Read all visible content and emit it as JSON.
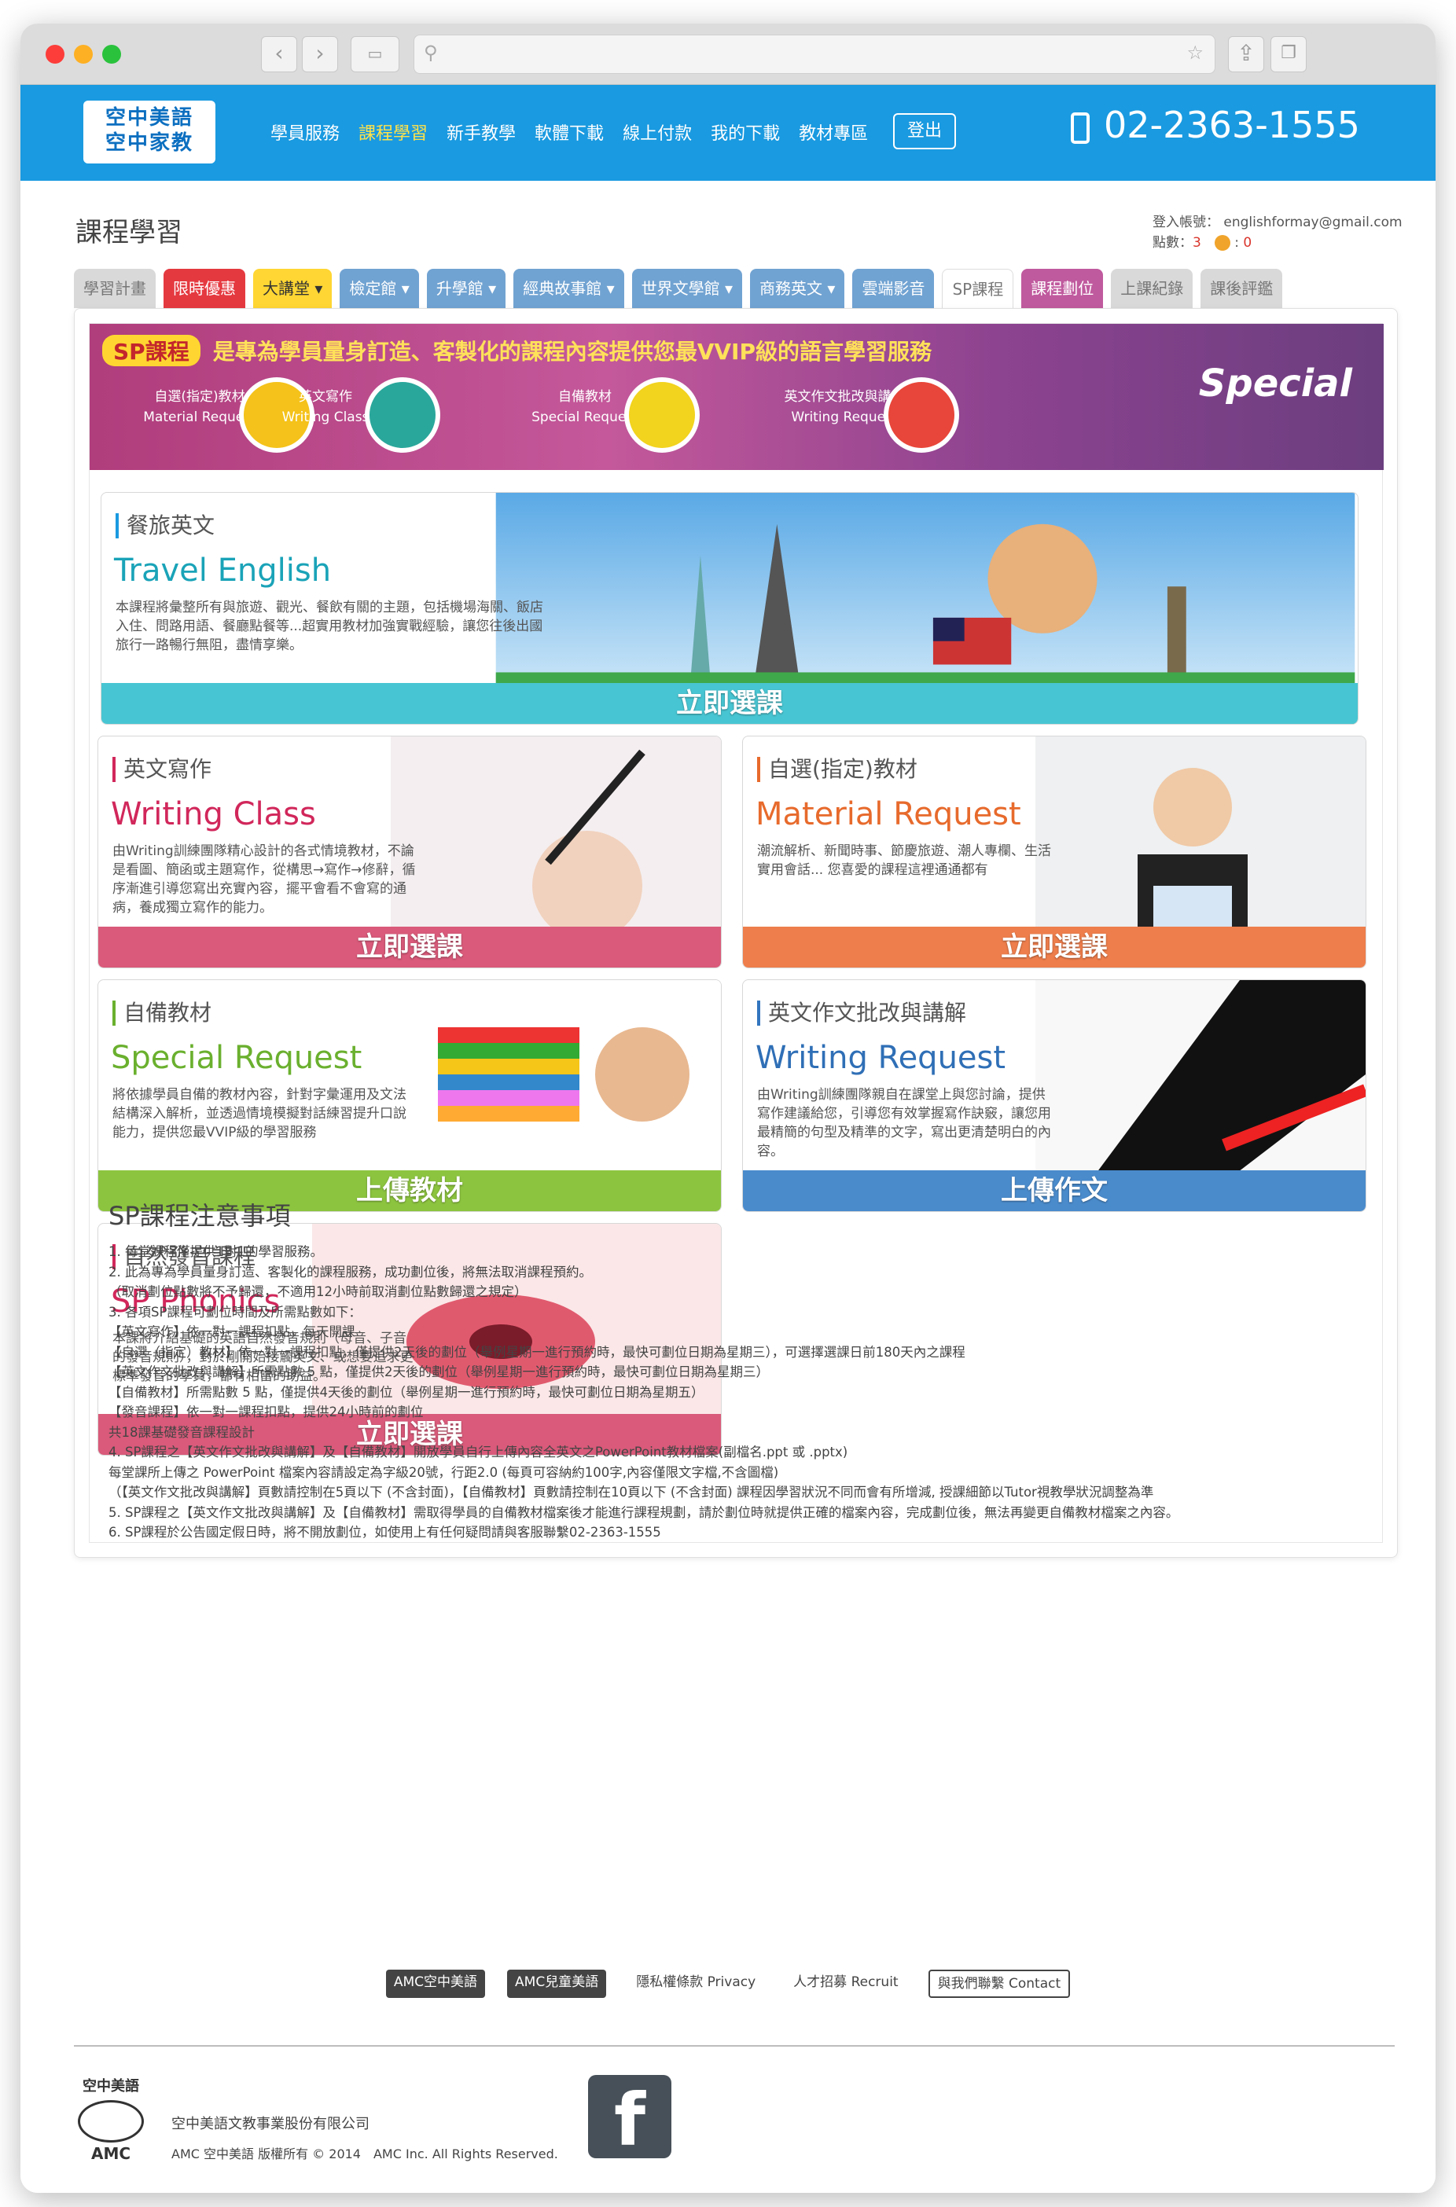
{
  "header": {
    "logo_line1": "空中美語",
    "logo_line2": "空中家教",
    "nav": [
      "學員服務",
      "課程學習",
      "新手教學",
      "軟體下載",
      "線上付款",
      "我的下載",
      "教材專區"
    ],
    "logout": "登出",
    "phone": "02-2363-1555"
  },
  "page": {
    "title": "課程學習",
    "account_label": "登入帳號：",
    "account": "englishformay@gmail.com",
    "points_label": "點數：",
    "points": "3",
    "coin_points": "0"
  },
  "tabs": [
    {
      "label": "學習計畫",
      "bg": "#d9d9d9",
      "color": "#777"
    },
    {
      "label": "限時優惠",
      "bg": "#e53940",
      "color": "#fff"
    },
    {
      "label": "大講堂 ▾",
      "bg": "#ffd633",
      "color": "#333"
    },
    {
      "label": "檢定館 ▾",
      "bg": "#71a3d2",
      "color": "#fff"
    },
    {
      "label": "升學館 ▾",
      "bg": "#71a3d2",
      "color": "#fff"
    },
    {
      "label": "經典故事館 ▾",
      "bg": "#71a3d2",
      "color": "#fff"
    },
    {
      "label": "世界文學館 ▾",
      "bg": "#71a3d2",
      "color": "#fff"
    },
    {
      "label": "商務英文 ▾",
      "bg": "#71a3d2",
      "color": "#fff"
    },
    {
      "label": "雲端影音",
      "bg": "#71a3d2",
      "color": "#fff"
    },
    {
      "label": "SP課程",
      "bg": "#ffffff",
      "color": "#777"
    },
    {
      "label": "課程劃位",
      "bg": "#c05a9e",
      "color": "#fff"
    },
    {
      "label": "上課紀錄",
      "bg": "#d9d9d9",
      "color": "#777"
    },
    {
      "label": "課後評鑑",
      "bg": "#d9d9d9",
      "color": "#777"
    }
  ],
  "banner": {
    "badge": "SP課程",
    "headline": "是專為學員量身訂造、客製化的課程內容提供您最VVIP級的語言學習服務",
    "items": [
      {
        "zh": "自選(指定)教材",
        "en": "Material Request"
      },
      {
        "zh": "英文寫作",
        "en": "Writing Class"
      },
      {
        "zh": "自備教材",
        "en": "Special Request"
      },
      {
        "zh": "英文作文批改與講解",
        "en": "Writing Request"
      }
    ],
    "special": "Special"
  },
  "cards": {
    "travel": {
      "zh": "餐旅英文",
      "en": "Travel English",
      "desc": "本課程將彙整所有與旅遊、觀光、餐飲有關的主題，包括機場海關、飯店入住、問路用語、餐廳點餐等...超實用教材加強實戰經驗，讓您往後出國旅行一路暢行無阻，盡情享樂。",
      "button": "立即選課"
    },
    "writing": {
      "zh": "英文寫作",
      "en": "Writing Class",
      "desc": "由Writing訓練團隊精心設計的各式情境教材，不論是看圖、簡函或主題寫作，從構思→寫作→修辭，循序漸進引導您寫出充實內容，擺平會看不會寫的通病，養成獨立寫作的能力。",
      "button": "立即選課"
    },
    "material": {
      "zh": "自選(指定)教材",
      "en": "Material Request",
      "desc": "潮流解析、新聞時事、節慶旅遊、潮人專欄、生活實用會話... 您喜愛的課程這裡通通都有",
      "button": "立即選課"
    },
    "special": {
      "zh": "自備教材",
      "en": "Special Request",
      "desc": "將依據學員自備的教材內容，針對字彙運用及文法結構深入解析，並透過情境模擬對話練習提升口說能力，提供您最VVIP級的學習服務",
      "button": "上傳教材"
    },
    "wrequest": {
      "zh": "英文作文批改與講解",
      "en": "Writing Request",
      "desc": "由Writing訓練團隊親自在課堂上與您討論，提供寫作建議給您，引導您有效掌握寫作訣竅，讓您用最精簡的句型及精準的文字，寫出更清楚明白的內容。",
      "button": "上傳作文"
    },
    "phonics": {
      "zh": "自然發音課程",
      "en": "SP Phonics",
      "desc": "本課將介紹基礎的英語自然發音規則（母音、子音的發音規則），對於剛開始接觸英文、或想要追求更標準發音的學員，都有相當的助益。",
      "button": "立即選課"
    }
  },
  "notes": {
    "title": "SP課程注意事項",
    "lines": [
      "1. 每堂課程僅提供1對1的學習服務。",
      "2. 此為專為學員量身訂造、客製化的課程服務，成功劃位後，將無法取消課程預約。",
      "（取消劃位點數將不予歸還，不適用12小時前取消劃位點數歸還之規定）",
      "3. 各項SP課程可劃位時間及所需點數如下：",
      "【英文寫作】依一對一課程扣點，每天開課",
      "【自選（指定）教材】依一對一課程扣點，僅提供2天後的劃位（舉例星期一進行預約時，最快可劃位日期為星期三），可選擇選課日前180天內之課程",
      "【英文作文批改與講解】所需點數 5 點，僅提供2天後的劃位（舉例星期一進行預約時，最快可劃位日期為星期三）",
      "【自備教材】所需點數 5 點，僅提供4天後的劃位（舉例星期一進行預約時，最快可劃位日期為星期五）",
      "【發音課程】依一對一課程扣點，提供24小時前的劃位",
      "共18課基礎發音課程設計",
      "4. SP課程之【英文作文批改與講解】及【自備教材】開放學員自行上傳內容全英文之PowerPoint教材檔案(副檔名.ppt 或 .pptx)",
      "每堂課所上傳之 PowerPoint 檔案內容請設定為字級20號，行距2.0 (每頁可容納約100字,內容僅限文字檔,不含圖檔)",
      "（【英文作文批改與講解】頁數請控制在5頁以下 (不含封面)，【自備教材】頁數請控制在10頁以下 (不含封面) 課程因學習狀況不同而會有所增減, 授課細節以Tutor視教學狀況調整為準",
      "5. SP課程之【英文作文批改與講解】及【自備教材】需取得學員的自備教材檔案後才能進行課程規劃，請於劃位時就提供正確的檔案內容，完成劃位後，無法再變更自備教材檔案之內容。",
      "6. SP課程於公告國定假日時，將不開放劃位，如使用上有任何疑問請與客服聯繫02-2363-1555"
    ]
  },
  "footer": {
    "links": [
      "AMC空中美語",
      "AMC兒童美語",
      "隱私權條款 Privacy",
      "人才招募 Recruit",
      "與我們聯繫 Contact"
    ],
    "logo_top": "空中美語",
    "logo_bottom": "AMC",
    "company": "空中美語文教事業股份有限公司",
    "copyright": "AMC 空中美語 版權所有 © 2014　AMC Inc. All Rights Reserved.",
    "fb": "f"
  }
}
